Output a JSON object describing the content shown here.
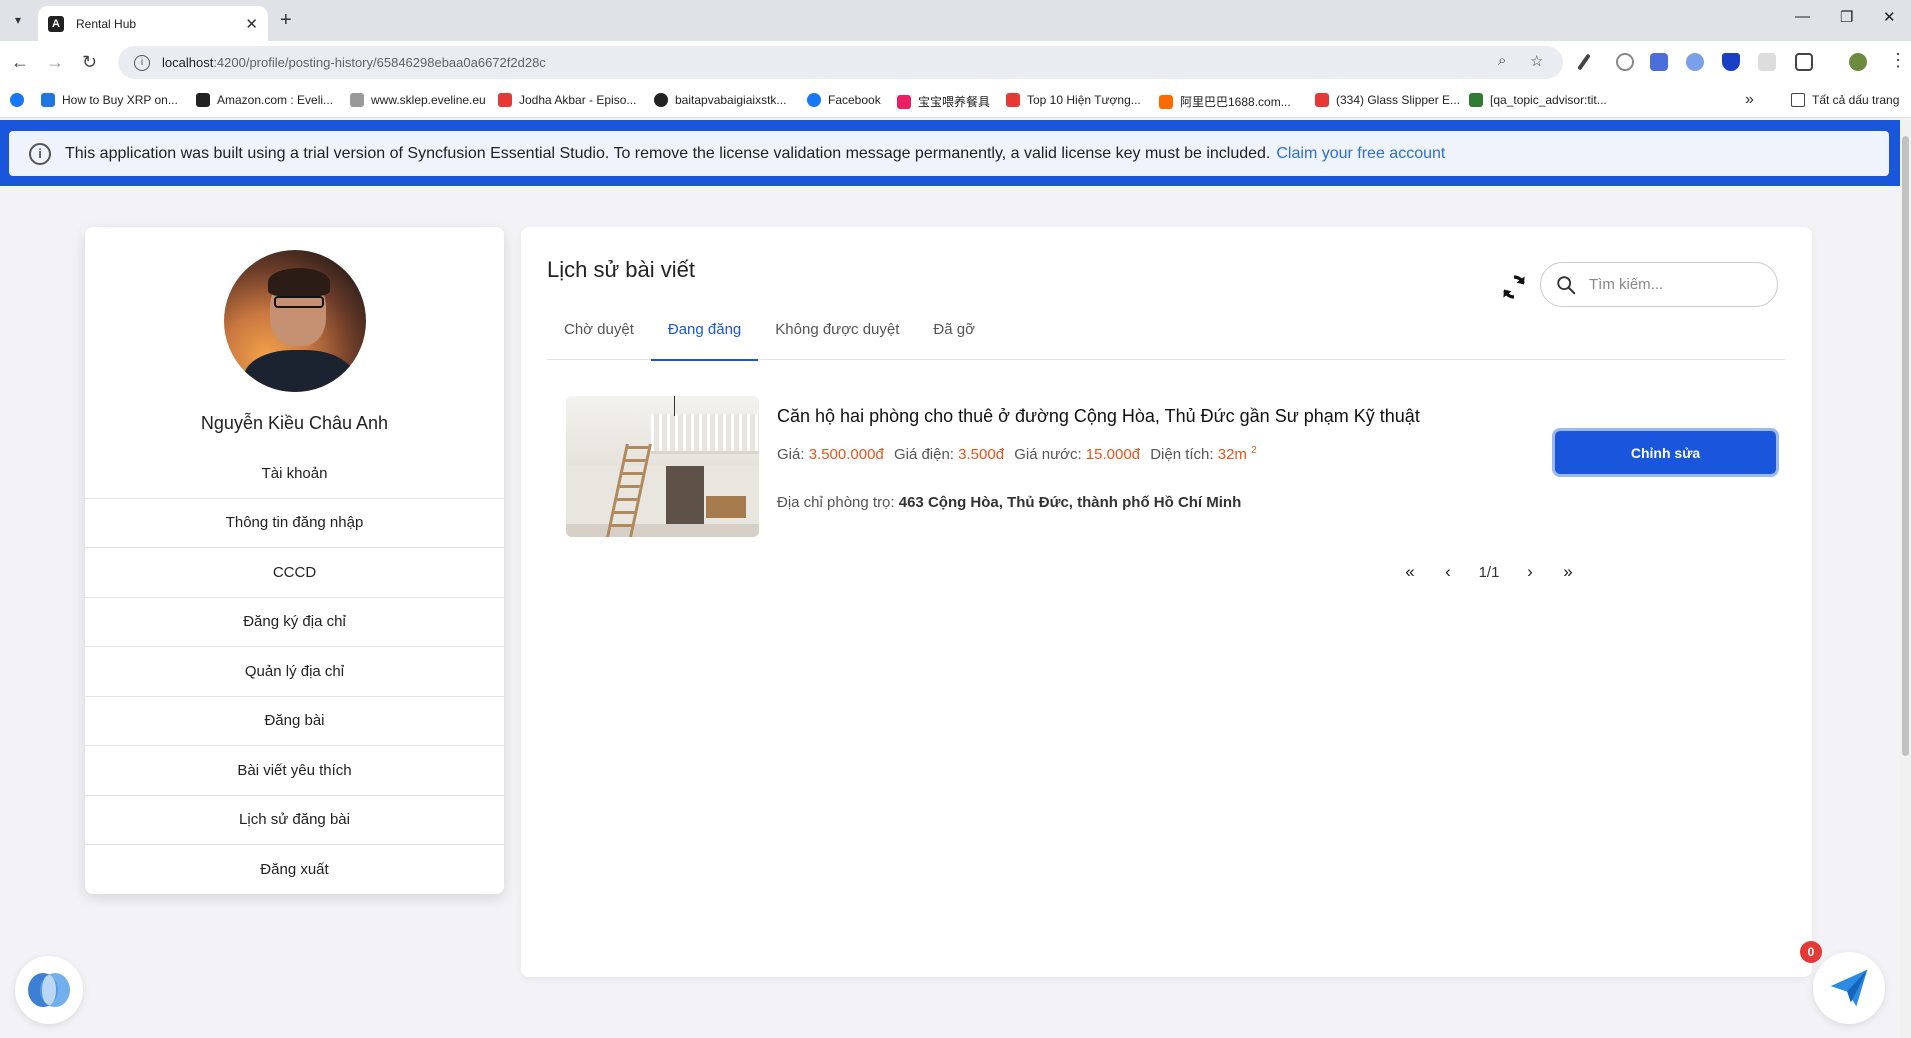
{
  "browser": {
    "tab_title": "Rental Hub",
    "url_host": "localhost",
    "url_rest": ":4200/profile/posting-history/65846298ebaa0a6672f2d28c",
    "bookmarks": [
      {
        "label": "How to Buy XRP on...",
        "color": "#1f76e0"
      },
      {
        "label": "Amazon.com : Eveli...",
        "color": "#222222"
      },
      {
        "label": "www.sklep.eveline.eu",
        "color": "#999999"
      },
      {
        "label": "Jodha Akbar - Episo...",
        "color": "#e53935"
      },
      {
        "label": "baitapvabaigiaixstk...",
        "color": "#222222"
      },
      {
        "label": "Facebook",
        "color": "#1877f2"
      },
      {
        "label": "宝宝喂养餐具",
        "color": "#e91e63"
      },
      {
        "label": "Top 10 Hiện Tượng...",
        "color": "#e53935"
      },
      {
        "label": "阿里巴巴1688.com...",
        "color": "#ff6a00"
      },
      {
        "label": "(334) Glass Slipper E...",
        "color": "#e53935"
      },
      {
        "label": "[qa_topic_advisor:tit...",
        "color": "#2e7d32"
      }
    ],
    "all_bookmarks": "Tất cả dấu trang"
  },
  "license": {
    "message": "This application was built using a trial version of Syncfusion Essential Studio. To remove the license validation message permanently, a valid license key must be included.",
    "link": "Claim your free account"
  },
  "profile": {
    "name": "Nguyễn Kiều Châu Anh",
    "menu": [
      "Tài khoản",
      "Thông tin đăng nhập",
      "CCCD",
      "Đăng ký địa chỉ",
      "Quản lý địa chỉ",
      "Đăng bài",
      "Bài viết yêu thích",
      "Lịch sử đăng bài",
      "Đăng xuất"
    ]
  },
  "main": {
    "title": "Lịch sử bài viết",
    "search_placeholder": "Tìm kiếm...",
    "tabs": [
      "Chờ duyệt",
      "Đang đăng",
      "Không được duyệt",
      "Đã gỡ"
    ],
    "active_tab": 1,
    "listing": {
      "title": "Căn hộ hai phòng cho thuê ở đường Cộng Hòa, Thủ Đức gần Sư phạm Kỹ thuật",
      "price_label": "Giá:",
      "price": "3.500.000đ",
      "electric_label": "Giá điện:",
      "electric": "3.500đ",
      "water_label": "Giá nước:",
      "water": "15.000đ",
      "area_label": "Diện tích:",
      "area": "32m",
      "area_sup": "2",
      "address_label": "Địa chỉ phòng trọ:",
      "address": "463 Cộng Hòa, Thủ Đức, thành phố Hồ Chí Minh",
      "edit_button": "Chỉnh sửa"
    },
    "pagination": "1/1"
  },
  "notification_count": "0"
}
